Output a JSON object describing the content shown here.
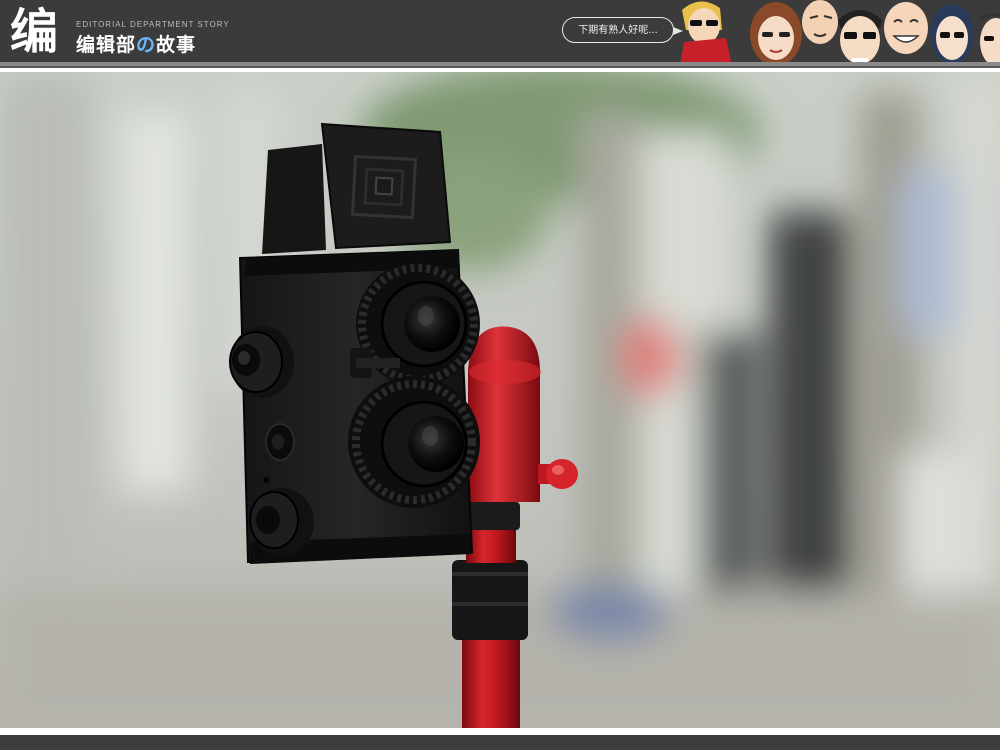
{
  "header": {
    "logo_glyph": "编",
    "subtitle": "EDITORIAL DEPARTMENT STORY",
    "title_part1": "编辑部",
    "title_accent": "の",
    "title_part2": "故事",
    "speech_text": "下期有熟人好呢...",
    "caricature_count": 7
  },
  "photo": {
    "subject": "twin-lens-reflex-camera-on-red-tripod"
  },
  "colors": {
    "header_bg": "#3b3b3b",
    "accent_blue": "#6ab8ff",
    "tripod_red": "#c4141a",
    "camera_black": "#1a1a1a"
  }
}
